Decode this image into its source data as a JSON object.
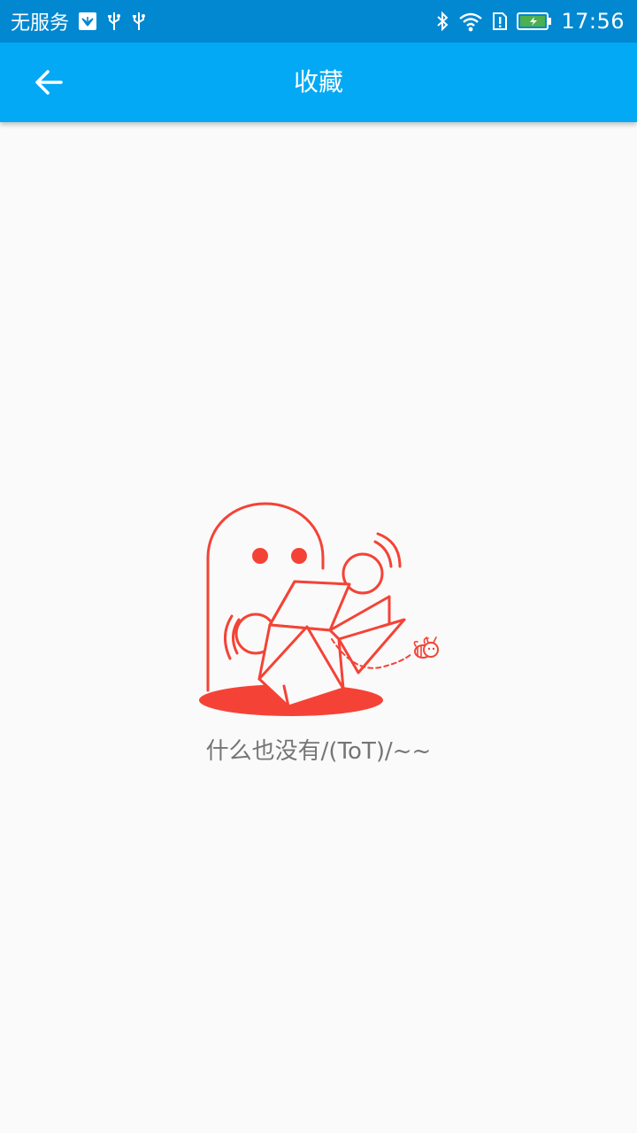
{
  "status_bar": {
    "carrier_text": "无服务",
    "time": "17:56",
    "left_icons": [
      "huawei-notification-icon",
      "usb-icon",
      "usb-icon"
    ],
    "right_icons": [
      "bluetooth-icon",
      "wifi-icon",
      "sim-alert-icon",
      "battery-charging-icon"
    ]
  },
  "app_bar": {
    "title": "收藏",
    "back_icon": "arrow-left-icon",
    "color": "#03a9f4"
  },
  "empty_state": {
    "illustration": "ghost-opening-box-illustration",
    "message": "什么也没有/(ToT)/~~",
    "accent_color": "#f44336"
  },
  "colors": {
    "status_bar": "#0288d1",
    "background": "#fafafa",
    "text_secondary": "#757575"
  }
}
